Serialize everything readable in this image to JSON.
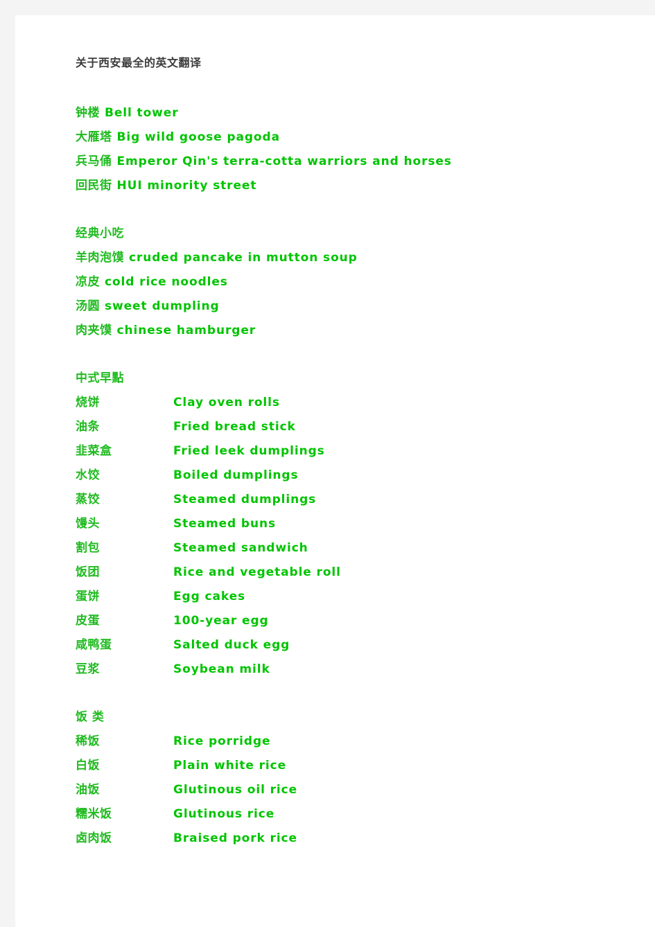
{
  "document": {
    "title": "关于西安最全的英文翻译",
    "page_background": "#ffffff",
    "margin_background": "#f4f4f4",
    "chinese_text_color": "#1fbb1f",
    "english_text_color": "#00c400",
    "title_color": "#3c3c3c"
  },
  "landmarks": [
    {
      "cn": "钟楼",
      "en": "Bell tower"
    },
    {
      "cn": "大雁塔",
      "en": "Big wild goose pagoda"
    },
    {
      "cn": "兵马俑",
      "en": "Emperor Qin's terra-cotta warriors and horses"
    },
    {
      "cn": "回民街",
      "en": "HUI minority street"
    }
  ],
  "snacks": {
    "heading": "经典小吃",
    "items": [
      {
        "cn": "羊肉泡馍",
        "en": "cruded pancake in mutton soup"
      },
      {
        "cn": "凉皮",
        "en": "cold rice noodles"
      },
      {
        "cn": "汤圆",
        "en": "sweet dumpling"
      },
      {
        "cn": "肉夹馍",
        "en": "chinese hamburger"
      }
    ]
  },
  "breakfast": {
    "heading": "中式早點",
    "items": [
      {
        "cn": "烧饼",
        "en": "Clay oven rolls"
      },
      {
        "cn": "油条",
        "en": "Fried bread stick"
      },
      {
        "cn": "韭菜盒",
        "en": "Fried leek dumplings"
      },
      {
        "cn": "水饺",
        "en": "Boiled dumplings"
      },
      {
        "cn": "蒸饺",
        "en": "Steamed dumplings"
      },
      {
        "cn": "馒头",
        "en": "Steamed buns"
      },
      {
        "cn": "割包",
        "en": "Steamed sandwich"
      },
      {
        "cn": "饭团",
        "en": "Rice and vegetable roll"
      },
      {
        "cn": "蛋饼",
        "en": "Egg cakes"
      },
      {
        "cn": "皮蛋",
        "en": "100-year egg"
      },
      {
        "cn": "咸鸭蛋",
        "en": "Salted duck egg"
      },
      {
        "cn": "豆浆",
        "en": "Soybean milk"
      }
    ]
  },
  "rice": {
    "heading": "饭 类",
    "items": [
      {
        "cn": "稀饭",
        "en": "Rice porridge"
      },
      {
        "cn": "白饭",
        "en": "Plain white rice"
      },
      {
        "cn": "油饭",
        "en": "Glutinous oil rice"
      },
      {
        "cn": "糯米饭",
        "en": "Glutinous rice"
      },
      {
        "cn": "卤肉饭",
        "en": "Braised pork rice"
      }
    ]
  }
}
